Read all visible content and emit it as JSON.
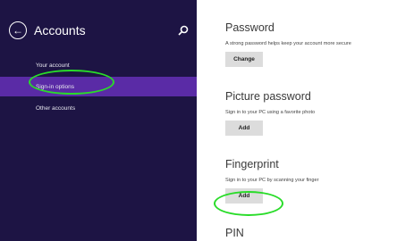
{
  "sidebar": {
    "back_icon": "back-arrow-icon",
    "title": "Accounts",
    "search_icon": "search-icon",
    "items": [
      {
        "label": "Your account",
        "selected": false
      },
      {
        "label": "Sign-in options",
        "selected": true
      },
      {
        "label": "Other accounts",
        "selected": false
      }
    ],
    "colors": {
      "background": "#1d1444",
      "selected": "#5a2ba6"
    }
  },
  "sections": [
    {
      "title": "Password",
      "description": "A strong password helps keep your account more secure",
      "button": "Change"
    },
    {
      "title": "Picture password",
      "description": "Sign in to your PC using a favorite photo",
      "button": "Add"
    },
    {
      "title": "Fingerprint",
      "description": "Sign in to your PC by scanning your finger",
      "button": "Add"
    },
    {
      "title": "PIN"
    }
  ],
  "highlight_color": "#29dc29"
}
